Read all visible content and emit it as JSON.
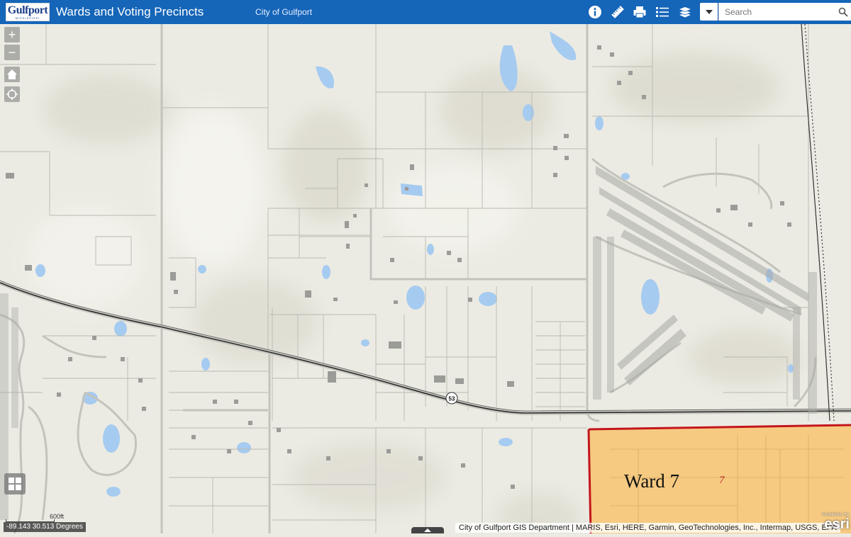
{
  "header": {
    "logo_text": "Gulfport",
    "logo_tagline": "MISSISSIPPI",
    "title": "Wards and Voting Precincts",
    "subtitle": "City of Gulfport",
    "tools": [
      "info-icon",
      "measure-icon",
      "print-icon",
      "legend-icon",
      "layers-icon"
    ]
  },
  "search": {
    "placeholder": "Search",
    "value": ""
  },
  "map_controls": {
    "zoom_in": "+",
    "zoom_out": "−",
    "home": "home-icon",
    "locate": "locate-icon",
    "basemap": "basemap-gallery-icon"
  },
  "map": {
    "highway_label": "53",
    "ward_label": "Ward 7",
    "precinct_label": "7",
    "ward_fill_color": "#f6c778",
    "ward_border_color": "#c4161c",
    "water_color": "#a6cbf0"
  },
  "footer": {
    "coordinates": "-89.143 30.513 Degrees",
    "scale_label": "600ft",
    "attribution": "City of Gulfport GIS Department | MARIS, Esri, HERE, Garmin, GeoTechnologies, Inc., Intermap, USGS, EPA",
    "esri_powered": "POWERED BY",
    "esri_text": "esri"
  }
}
